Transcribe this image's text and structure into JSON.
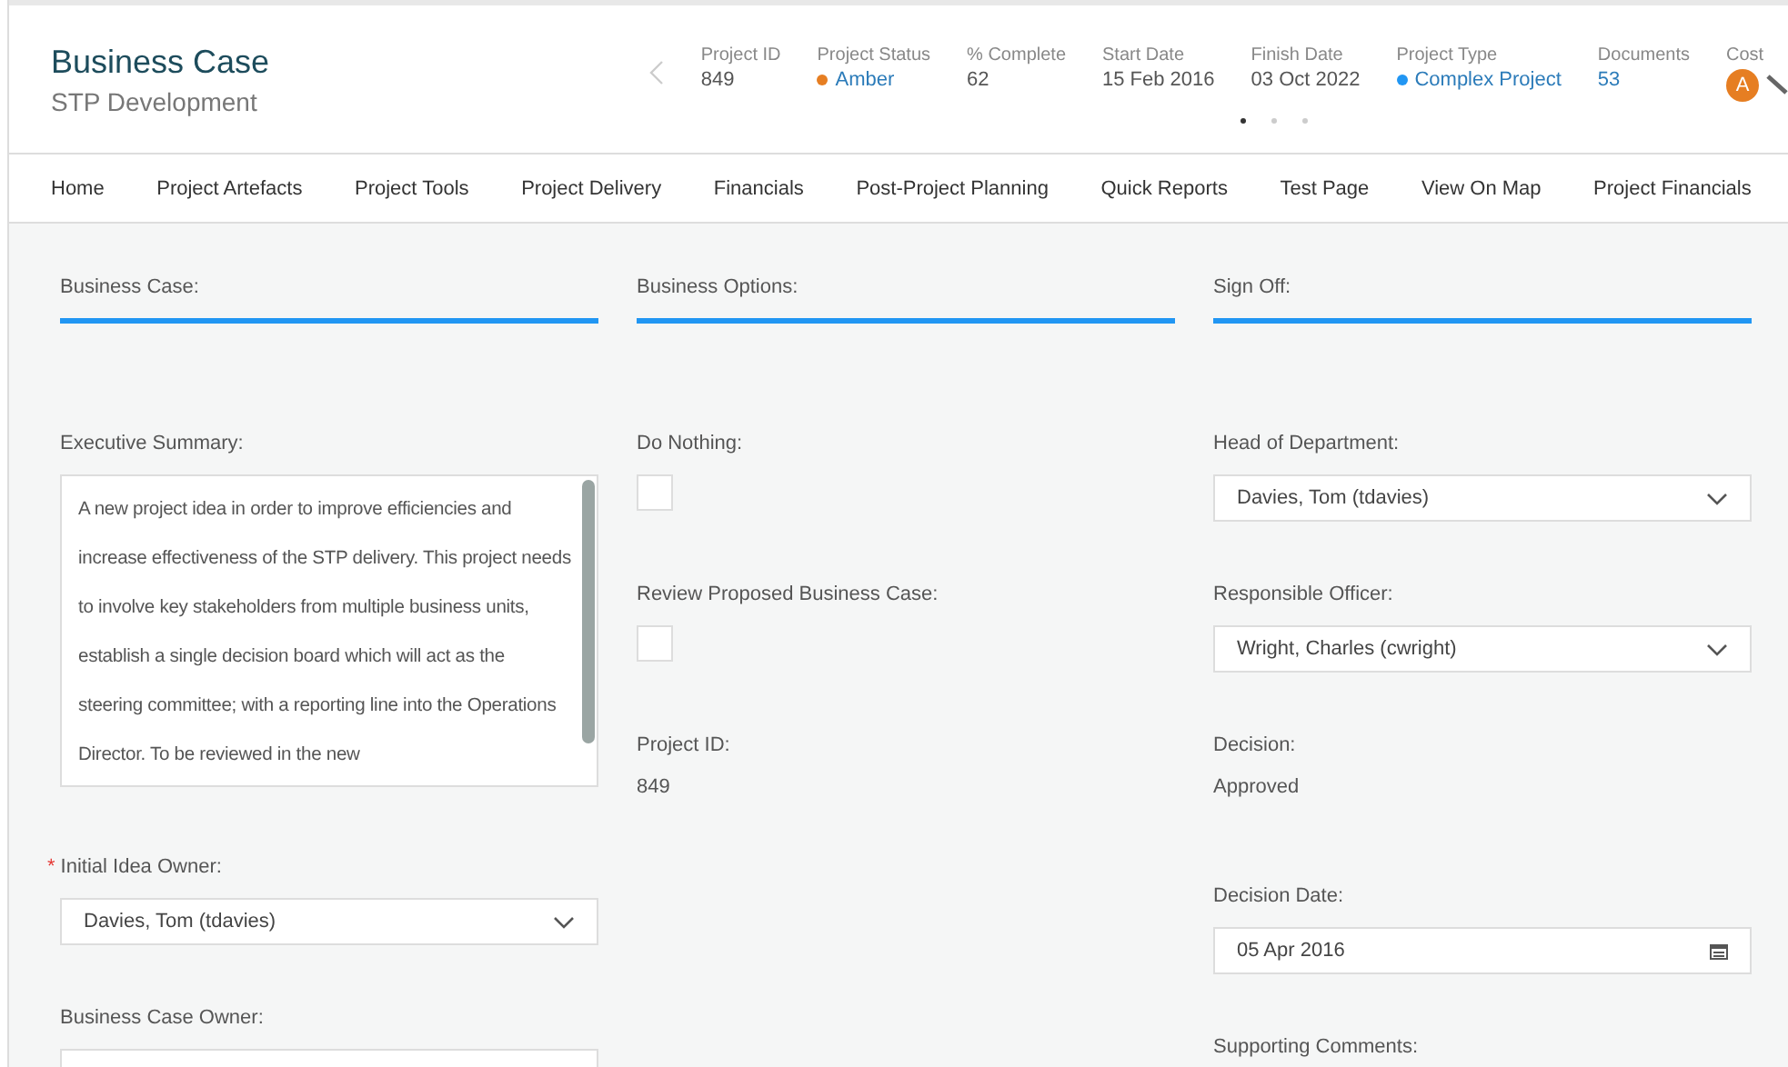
{
  "header": {
    "title": "Business Case",
    "subtitle": "STP Development",
    "metrics": [
      {
        "label": "Project ID",
        "value": "849",
        "kind": "plain"
      },
      {
        "label": "Project Status",
        "value": "Amber",
        "kind": "dot",
        "color": "#e67e22"
      },
      {
        "label": "% Complete",
        "value": "62",
        "kind": "plain"
      },
      {
        "label": "Start Date",
        "value": "15 Feb 2016",
        "kind": "plain"
      },
      {
        "label": "Finish Date",
        "value": "03 Oct 2022",
        "kind": "plain"
      },
      {
        "label": "Project Type",
        "value": "Complex Project",
        "kind": "dot",
        "color": "#2196f3"
      },
      {
        "label": "Documents",
        "value": "53",
        "kind": "link"
      },
      {
        "label": "Cost",
        "value": "A",
        "kind": "badge"
      }
    ],
    "pages": [
      {
        "selected": true
      },
      {
        "selected": false
      },
      {
        "selected": false
      }
    ]
  },
  "nav": [
    {
      "label": "Home"
    },
    {
      "label": "Project Artefacts"
    },
    {
      "label": "Project Tools"
    },
    {
      "label": "Project Delivery"
    },
    {
      "label": "Financials"
    },
    {
      "label": "Post-Project Planning"
    },
    {
      "label": "Quick Reports"
    },
    {
      "label": "Test Page"
    },
    {
      "label": "View On Map"
    },
    {
      "label": "Project Financials"
    }
  ],
  "columns": [
    {
      "heading": "Business Case:",
      "fields": [
        {
          "kind": "textarea",
          "label": "Executive Summary:",
          "value": "A new project idea in order to improve efficiencies and increase effectiveness of the STP delivery. This project needs to involve key stakeholders from multiple business units, establish a single decision board which will act as the steering committee; with a reporting line into the Operations Director. To be reviewed in the new"
        },
        {
          "kind": "select",
          "label": "Initial Idea Owner:",
          "required_mark": "*",
          "value": "Davies, Tom (tdavies)"
        },
        {
          "kind": "select",
          "label": "Business Case Owner:"
        }
      ]
    },
    {
      "heading": "Business Options:",
      "fields": [
        {
          "kind": "checkbox",
          "label": "Do Nothing:",
          "checked": false
        },
        {
          "kind": "checkbox",
          "label": "Review Proposed Business Case:",
          "checked": false
        },
        {
          "kind": "readonly",
          "label": "Project ID:",
          "value": "849"
        }
      ]
    },
    {
      "heading": "Sign Off:",
      "fields": [
        {
          "kind": "select",
          "label": "Head of Department:",
          "value": "Davies, Tom (tdavies)"
        },
        {
          "kind": "select",
          "label": "Responsible Officer:",
          "value": "Wright, Charles (cwright)"
        },
        {
          "kind": "readonly",
          "label": "Decision:",
          "value": "Approved"
        },
        {
          "kind": "date",
          "label": "Decision Date:",
          "value": "05 Apr 2016"
        },
        {
          "kind": "label",
          "label": "Supporting Comments:"
        }
      ]
    }
  ]
}
